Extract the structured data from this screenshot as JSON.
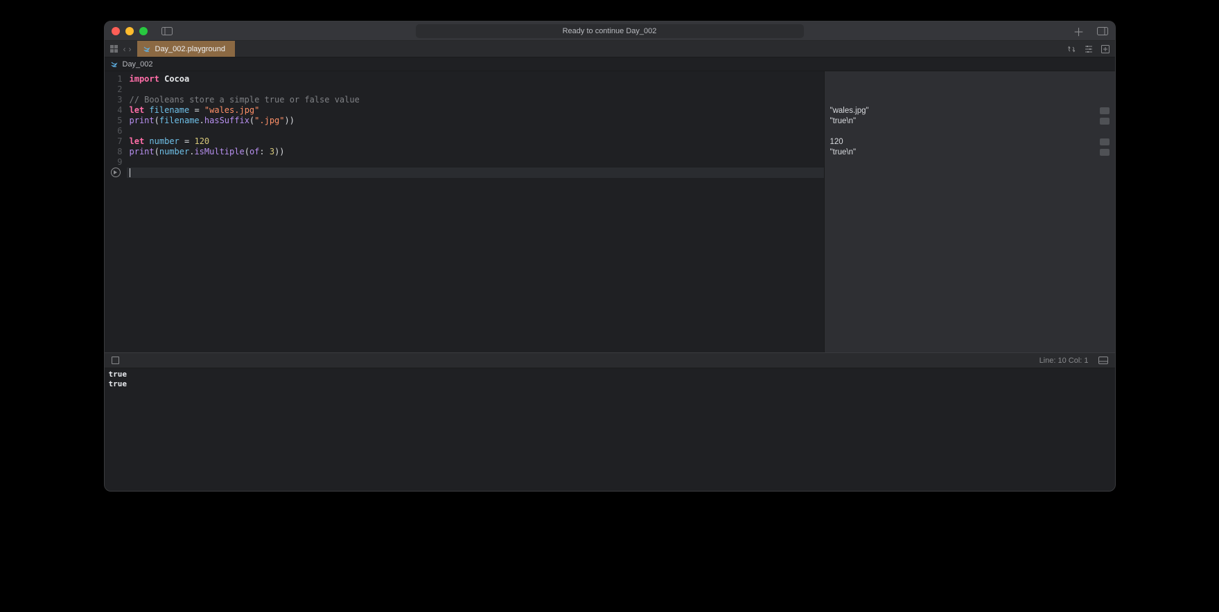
{
  "titlebar": {
    "status": "Ready to continue Day_002"
  },
  "tab": {
    "label": "Day_002.playground"
  },
  "breadcrumb": {
    "label": "Day_002"
  },
  "code": {
    "lines": [
      {
        "n": 1,
        "tokens": [
          [
            "kw",
            "import"
          ],
          [
            "sp",
            " "
          ],
          [
            "type",
            "Cocoa"
          ]
        ]
      },
      {
        "n": 2,
        "tokens": []
      },
      {
        "n": 3,
        "tokens": [
          [
            "cmt",
            "// Booleans store a simple true or false value"
          ]
        ]
      },
      {
        "n": 4,
        "tokens": [
          [
            "kw",
            "let"
          ],
          [
            "sp",
            " "
          ],
          [
            "ident",
            "filename"
          ],
          [
            "sp",
            " "
          ],
          [
            "paren",
            "= "
          ],
          [
            "str",
            "\"wales.jpg\""
          ]
        ]
      },
      {
        "n": 5,
        "tokens": [
          [
            "fn",
            "print"
          ],
          [
            "paren",
            "("
          ],
          [
            "ident",
            "filename"
          ],
          [
            "paren",
            "."
          ],
          [
            "fn",
            "hasSuffix"
          ],
          [
            "paren",
            "("
          ],
          [
            "str",
            "\".jpg\""
          ],
          [
            "paren",
            "))"
          ]
        ]
      },
      {
        "n": 6,
        "tokens": []
      },
      {
        "n": 7,
        "tokens": [
          [
            "kw",
            "let"
          ],
          [
            "sp",
            " "
          ],
          [
            "ident",
            "number"
          ],
          [
            "sp",
            " "
          ],
          [
            "paren",
            "= "
          ],
          [
            "num",
            "120"
          ]
        ]
      },
      {
        "n": 8,
        "tokens": [
          [
            "fn",
            "print"
          ],
          [
            "paren",
            "("
          ],
          [
            "ident",
            "number"
          ],
          [
            "paren",
            "."
          ],
          [
            "fn",
            "isMultiple"
          ],
          [
            "paren",
            "("
          ],
          [
            "param",
            "of"
          ],
          [
            "paren",
            ": "
          ],
          [
            "num",
            "3"
          ],
          [
            "paren",
            "))"
          ]
        ]
      },
      {
        "n": 9,
        "tokens": []
      }
    ],
    "cursor_line": 10
  },
  "results": [
    {
      "offset": 3,
      "text": "\"wales.jpg\""
    },
    {
      "offset": 4,
      "text": "\"true\\n\""
    },
    {
      "offset": 6,
      "text": "120"
    },
    {
      "offset": 7,
      "text": "\"true\\n\""
    }
  ],
  "console_bar": {
    "position": "Line: 10  Col: 1"
  },
  "console": {
    "lines": [
      "true",
      "true"
    ]
  }
}
